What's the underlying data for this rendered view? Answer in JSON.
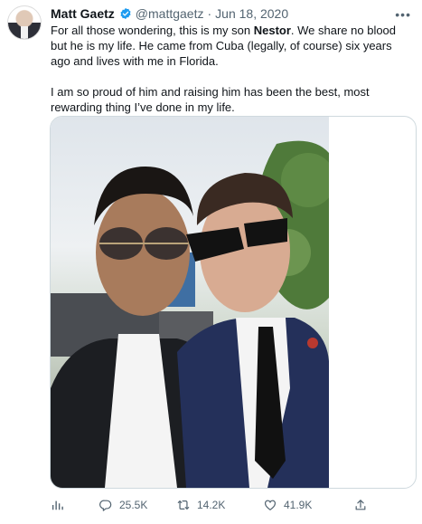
{
  "tweet": {
    "author_name": "Matt Gaetz",
    "handle": "@mattgaetz",
    "separator": "·",
    "date": "Jun 18, 2020",
    "more": "•••",
    "text1_before": "For all those wondering, this is my son ",
    "text1_bold": "Nestor",
    "text1_after": ".  We share no blood but he is my life. He came from Cuba (legally, of course) six years ago and lives with me in Florida.",
    "text2": "I am so proud of him and raising him has been the best, most rewarding thing I’ve done in my life."
  },
  "metrics": {
    "replies": "25.5K",
    "retweets": "14.2K",
    "likes": "41.9K"
  },
  "icons": {
    "verified": "verified-badge-icon",
    "analytics": "analytics-icon",
    "reply": "reply-icon",
    "retweet": "retweet-icon",
    "like": "heart-icon",
    "share": "share-icon"
  },
  "colors": {
    "verified_blue": "#1d9bf0",
    "secondary_text": "#536471",
    "primary_text": "#0f1419",
    "border": "#cfd9de"
  }
}
